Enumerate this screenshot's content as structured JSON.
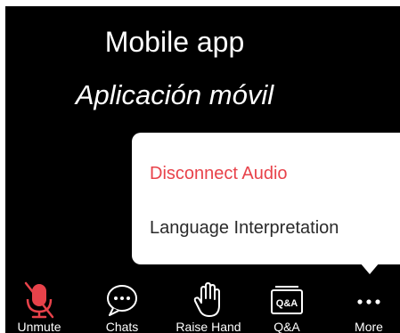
{
  "captions": {
    "english": "Mobile app",
    "spanish": "Aplicación móvil"
  },
  "audio_menu": {
    "disconnect_audio": "Disconnect Audio",
    "language_interpretation": "Language Interpretation"
  },
  "toolbar": {
    "unmute": {
      "label": "Unmute",
      "icon": "microphone-muted-icon"
    },
    "chats": {
      "label": "Chats",
      "icon": "chat-bubble-icon"
    },
    "raise_hand": {
      "label": "Raise Hand",
      "icon": "hand-icon"
    },
    "qa": {
      "label": "Q&A",
      "icon": "qa-icon",
      "icon_text": "Q&A"
    },
    "more": {
      "label": "More",
      "icon": "more-dots-icon"
    }
  },
  "colors": {
    "background": "#000000",
    "disconnect_red": "#e8424a",
    "mute_red": "#e8424a",
    "menu_background": "#ffffff"
  }
}
